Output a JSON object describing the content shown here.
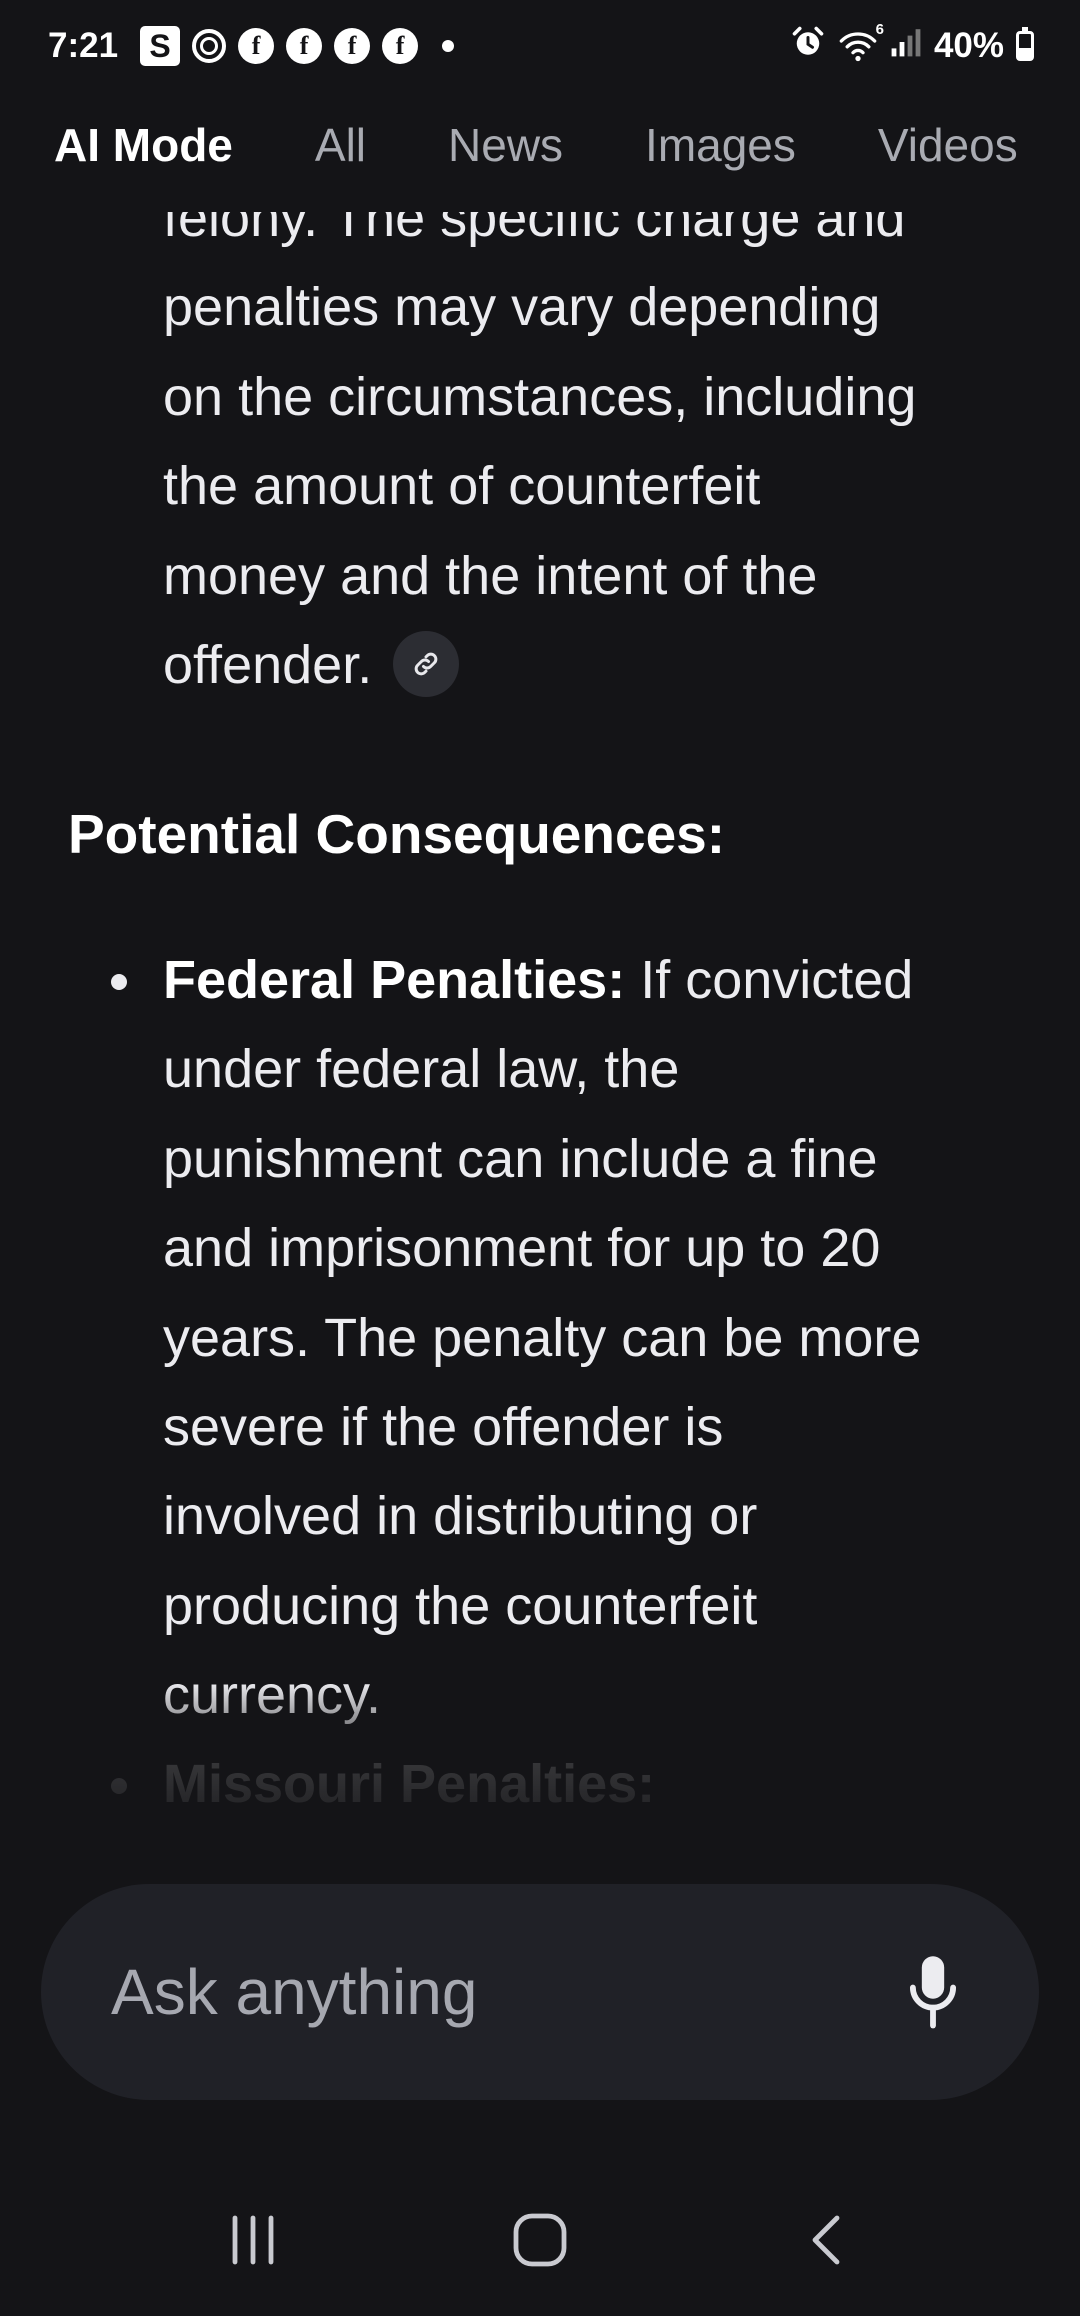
{
  "status_bar": {
    "time": "7:21",
    "notification_icons": [
      "s-app-icon",
      "threads-icon",
      "facebook-icon",
      "facebook-icon",
      "facebook-icon",
      "facebook-icon",
      "more-dot-icon"
    ],
    "s_icon_letter": "S",
    "fb_letter": "f",
    "battery": "40%",
    "battery_level": 0.4,
    "right_icons": [
      "alarm-icon",
      "wifi-icon",
      "signal-icon",
      "battery-icon"
    ],
    "wifi_badge": "6"
  },
  "tabs": [
    {
      "label": "AI Mode",
      "active": true
    },
    {
      "label": "All",
      "active": false
    },
    {
      "label": "News",
      "active": false
    },
    {
      "label": "Images",
      "active": false
    },
    {
      "label": "Videos",
      "active": false
    }
  ],
  "content": {
    "para_lines": [
      "felony. The specific charge and",
      "penalties may vary depending",
      "on the circumstances, including",
      "the amount of counterfeit",
      "money and the intent of the",
      "offender."
    ],
    "heading": "Potential Consequences:",
    "bullets": [
      {
        "bold": "Federal Penalties:",
        "first_line_rest": " If convicted",
        "lines": [
          "under federal law, the",
          "punishment can include a fine",
          "and imprisonment for up to 20",
          "years. The penalty can be more",
          "severe if the offender is",
          "involved in distributing or",
          "producing the counterfeit",
          "currency."
        ]
      },
      {
        "bold": "Missouri Penalties:",
        "first_line_rest": "",
        "lines": []
      }
    ]
  },
  "ask_bar": {
    "placeholder": "Ask anything",
    "mic_icon": "microphone-icon"
  },
  "nav_bar": {
    "buttons": [
      "recent-apps-icon",
      "home-icon",
      "back-icon"
    ]
  },
  "colors": {
    "background": "#141417",
    "input_bg": "#202127",
    "tab_inactive": "#a9abb2",
    "text": "#ececf0"
  }
}
